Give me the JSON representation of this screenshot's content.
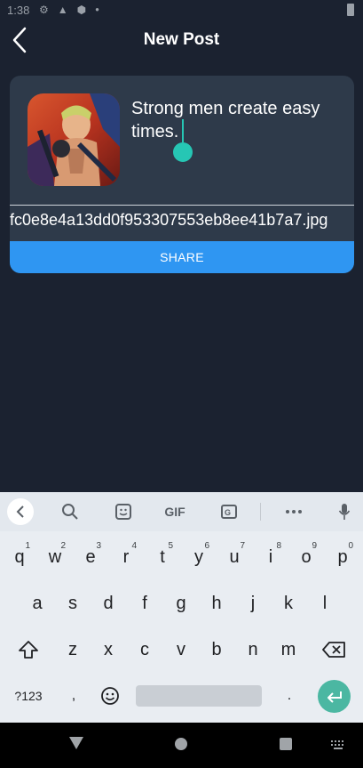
{
  "status": {
    "time": "1:38"
  },
  "header": {
    "title": "New Post"
  },
  "post": {
    "caption": "Strong men create easy times.",
    "filename": "fc0e8e4a13dd0f953307553eb8ee41b7a7.jpg",
    "share_label": "SHARE"
  },
  "keyboard": {
    "toolbar": {
      "gif_label": "GIF"
    },
    "row1": [
      {
        "k": "q",
        "h": "1"
      },
      {
        "k": "w",
        "h": "2"
      },
      {
        "k": "e",
        "h": "3"
      },
      {
        "k": "r",
        "h": "4"
      },
      {
        "k": "t",
        "h": "5"
      },
      {
        "k": "y",
        "h": "6"
      },
      {
        "k": "u",
        "h": "7"
      },
      {
        "k": "i",
        "h": "8"
      },
      {
        "k": "o",
        "h": "9"
      },
      {
        "k": "p",
        "h": "0"
      }
    ],
    "row2": [
      "a",
      "s",
      "d",
      "f",
      "g",
      "h",
      "j",
      "k",
      "l"
    ],
    "row3": [
      "z",
      "x",
      "c",
      "v",
      "b",
      "n",
      "m"
    ],
    "symbols_label": "?123",
    "comma_label": ",",
    "period_label": "."
  },
  "colors": {
    "accent": "#2f96f2",
    "cursor": "#26c6b4",
    "enter": "#4bb7a2",
    "background": "#1b2230",
    "card": "#2e3a4a"
  }
}
